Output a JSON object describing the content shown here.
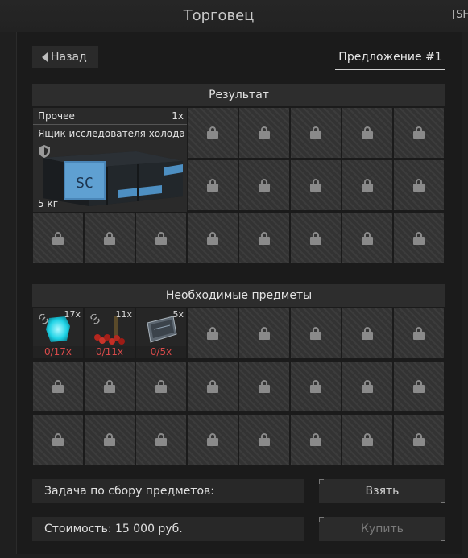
{
  "header": {
    "title": "Торговец",
    "tag": "[SH"
  },
  "nav": {
    "back_label": "Назад",
    "offer_label": "Предложение #1"
  },
  "result": {
    "title": "Результат",
    "item": {
      "category": "Прочее",
      "quantity": "1x",
      "name": "Ящик исследователя холода",
      "weight": "5 кг",
      "crate_label": "SC"
    }
  },
  "required": {
    "title": "Необходимые предметы",
    "items": [
      {
        "required_qty": "17x",
        "have": "0/17x",
        "icon": "cyan-crystal-icon"
      },
      {
        "required_qty": "11x",
        "have": "0/11x",
        "icon": "red-berries-icon"
      },
      {
        "required_qty": "5x",
        "have": "0/5x",
        "icon": "metal-plate-icon"
      }
    ]
  },
  "footer": {
    "task_label": "Задача по сбору предметов:",
    "take_label": "Взять",
    "cost_label": "Стоимость: 15 000  руб.",
    "buy_label": "Купить"
  },
  "colors": {
    "missing": "#d84a4a",
    "take_text": "#d0d0d0",
    "buy_text": "#7a7a7a"
  }
}
